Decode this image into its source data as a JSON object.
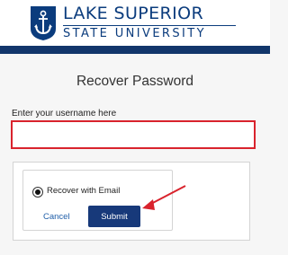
{
  "header": {
    "logo_line1": "LAKE SUPERIOR",
    "logo_line2": "STATE UNIVERSITY",
    "logo_icon": "anchor-shield-icon",
    "brand_color": "#0b3c7d",
    "bar_color": "#12366b"
  },
  "main": {
    "title": "Recover Password",
    "username_label": "Enter your username here",
    "username_value": "",
    "username_placeholder": "",
    "recover_option_label": "Recover with Email",
    "recover_option_selected": true,
    "cancel_label": "Cancel",
    "submit_label": "Submit",
    "accent_color": "#17397a",
    "highlight_color": "#d9232d"
  }
}
